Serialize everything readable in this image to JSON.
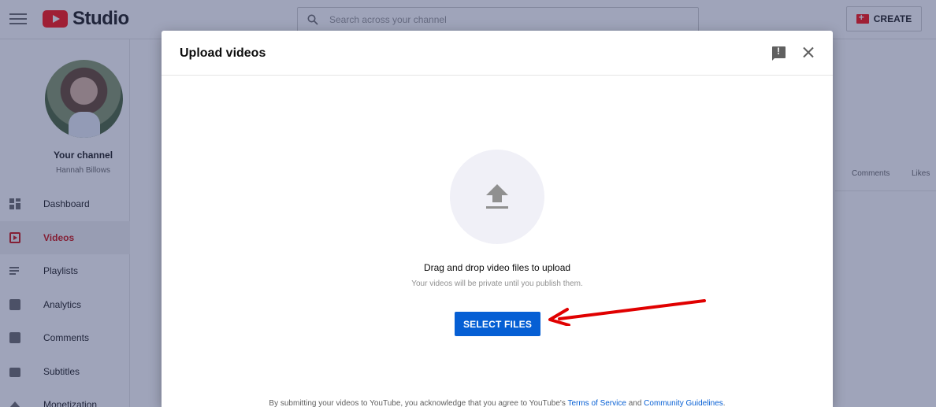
{
  "app": {
    "logo_text": "Studio",
    "search_placeholder": "Search across your channel",
    "create_label": "CREATE"
  },
  "sidebar": {
    "channel_title": "Your channel",
    "channel_name": "Hannah Billows",
    "items": [
      {
        "label": "Dashboard",
        "icon": "dashboard-icon"
      },
      {
        "label": "Videos",
        "icon": "videos-icon",
        "active": true
      },
      {
        "label": "Playlists",
        "icon": "playlists-icon"
      },
      {
        "label": "Analytics",
        "icon": "analytics-icon"
      },
      {
        "label": "Comments",
        "icon": "comments-icon"
      },
      {
        "label": "Subtitles",
        "icon": "subtitles-icon"
      },
      {
        "label": "Monetization",
        "icon": "monetization-icon"
      }
    ]
  },
  "table": {
    "columns": [
      "Comments",
      "Likes"
    ]
  },
  "dialog": {
    "title": "Upload videos",
    "drag_text": "Drag and drop video files to upload",
    "private_text": "Your videos will be private until you publish them.",
    "select_button": "SELECT FILES",
    "footer_prefix": "By submitting your videos to YouTube, you acknowledge that you agree to YouTube's ",
    "terms_link": "Terms of Service",
    "footer_and": " and ",
    "guidelines_link": "Community Guidelines",
    "footer_suffix": "."
  },
  "colors": {
    "accent": "#065fd4",
    "brand": "#ff0000",
    "annotation": "#e00000"
  }
}
